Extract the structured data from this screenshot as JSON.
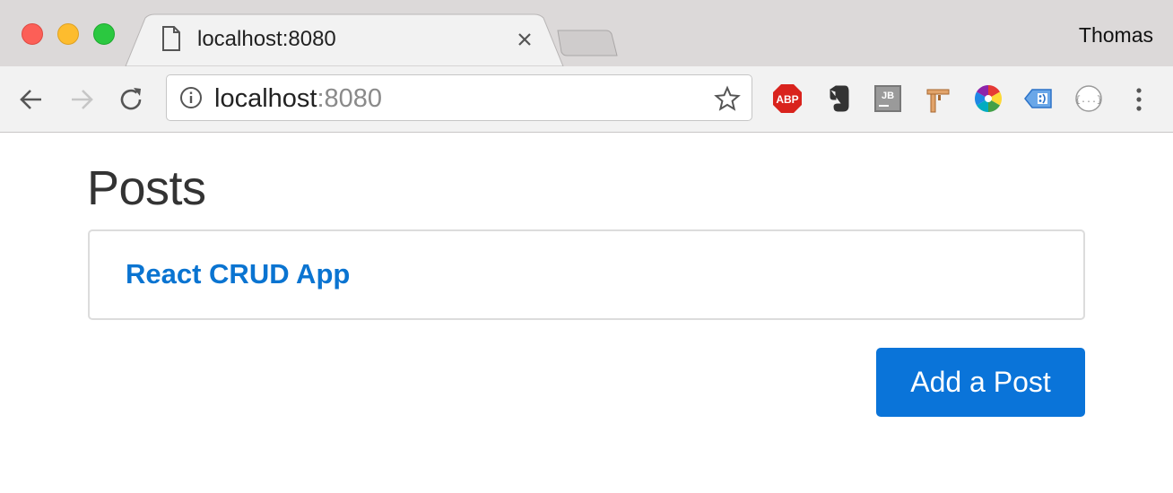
{
  "window": {
    "tab": {
      "title": "localhost:8080"
    },
    "profile_name": "Thomas"
  },
  "toolbar": {
    "url_host": "localhost",
    "url_port": ":8080",
    "extensions": [
      "adblock-plus-icon",
      "evernote-icon",
      "jetbrains-icon",
      "construction-icon",
      "color-picker-icon",
      "tag-icon",
      "json-viewer-icon"
    ]
  },
  "page": {
    "title": "Posts",
    "posts": [
      {
        "title": "React CRUD App"
      }
    ],
    "add_button_label": "Add a Post"
  },
  "colors": {
    "accent": "#0a74d9",
    "link": "#0a74d1"
  }
}
